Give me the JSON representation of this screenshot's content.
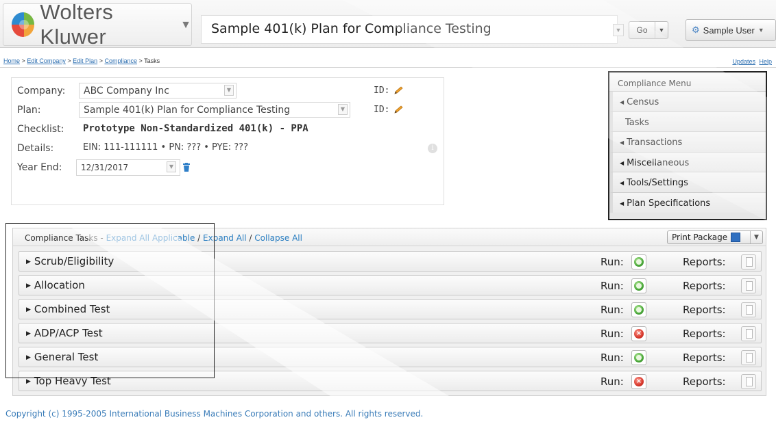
{
  "header": {
    "brand": "Wolters Kluwer",
    "plan_selector": "Sample 401(k) Plan for Compliance Testing",
    "go_label": "Go",
    "user_label": "Sample User"
  },
  "breadcrumb": {
    "items": [
      "Home",
      "Edit Company",
      "Edit Plan",
      "Compliance"
    ],
    "current": "Tasks",
    "separator": ">"
  },
  "help_links": [
    "Updates",
    "Help"
  ],
  "plan_info": {
    "company_label": "Company:",
    "company_value": "ABC Company Inc",
    "plan_label": "Plan:",
    "plan_value": "Sample 401(k) Plan for Compliance Testing",
    "id_label": "ID:",
    "checklist_label": "Checklist:",
    "checklist_value": "Prototype Non-Standardized 401(k) - PPA",
    "details_label": "Details:",
    "details_value": "EIN: 111-111111 • PN: ??? • PYE: ???",
    "year_end_label": "Year End:",
    "year_end_value": "12/31/2017"
  },
  "compliance_menu": {
    "title": "Compliance Menu",
    "items": [
      {
        "label": "Census",
        "expandable": true
      },
      {
        "label": "Tasks",
        "expandable": false
      },
      {
        "label": "Transactions",
        "expandable": true
      },
      {
        "label": "Miscellaneous",
        "expandable": true
      },
      {
        "label": "Tools/Settings",
        "expandable": true
      },
      {
        "label": "Plan Specifications",
        "expandable": true
      }
    ]
  },
  "tasks_panel": {
    "title": "Compliance Tasks - ",
    "expand_applicable": "Expand All Applicable",
    "sep": " / ",
    "expand_all": "Expand All",
    "collapse_all": "Collapse All",
    "print_package": "Print Package",
    "run_label": "Run:",
    "reports_label": "Reports:",
    "rows": [
      {
        "name": "Scrub/Eligibility",
        "status": "pass"
      },
      {
        "name": "Allocation",
        "status": "pass"
      },
      {
        "name": "Combined Test",
        "status": "pass"
      },
      {
        "name": "ADP/ACP Test",
        "status": "fail"
      },
      {
        "name": "General Test",
        "status": "pass"
      },
      {
        "name": "Top Heavy Test",
        "status": "fail"
      }
    ]
  },
  "footer": {
    "copyright": "Copyright (c) 1995-2005 International Business Machines Corporation and others. All rights reserved."
  },
  "colors": {
    "link": "#2a7ec1",
    "pass": "#4aa83a",
    "fail": "#d7382c",
    "brand_text": "#585858"
  },
  "icons": {
    "logo": "wolters-kluwer-logo-icon",
    "user": "gear-icon",
    "edit": "pencil-icon",
    "delete": "trash-icon",
    "info": "info-icon",
    "pdf": "pdf-icon",
    "run_pass": "check-circle-icon",
    "run_fail": "error-circle-icon",
    "report": "document-icon"
  }
}
